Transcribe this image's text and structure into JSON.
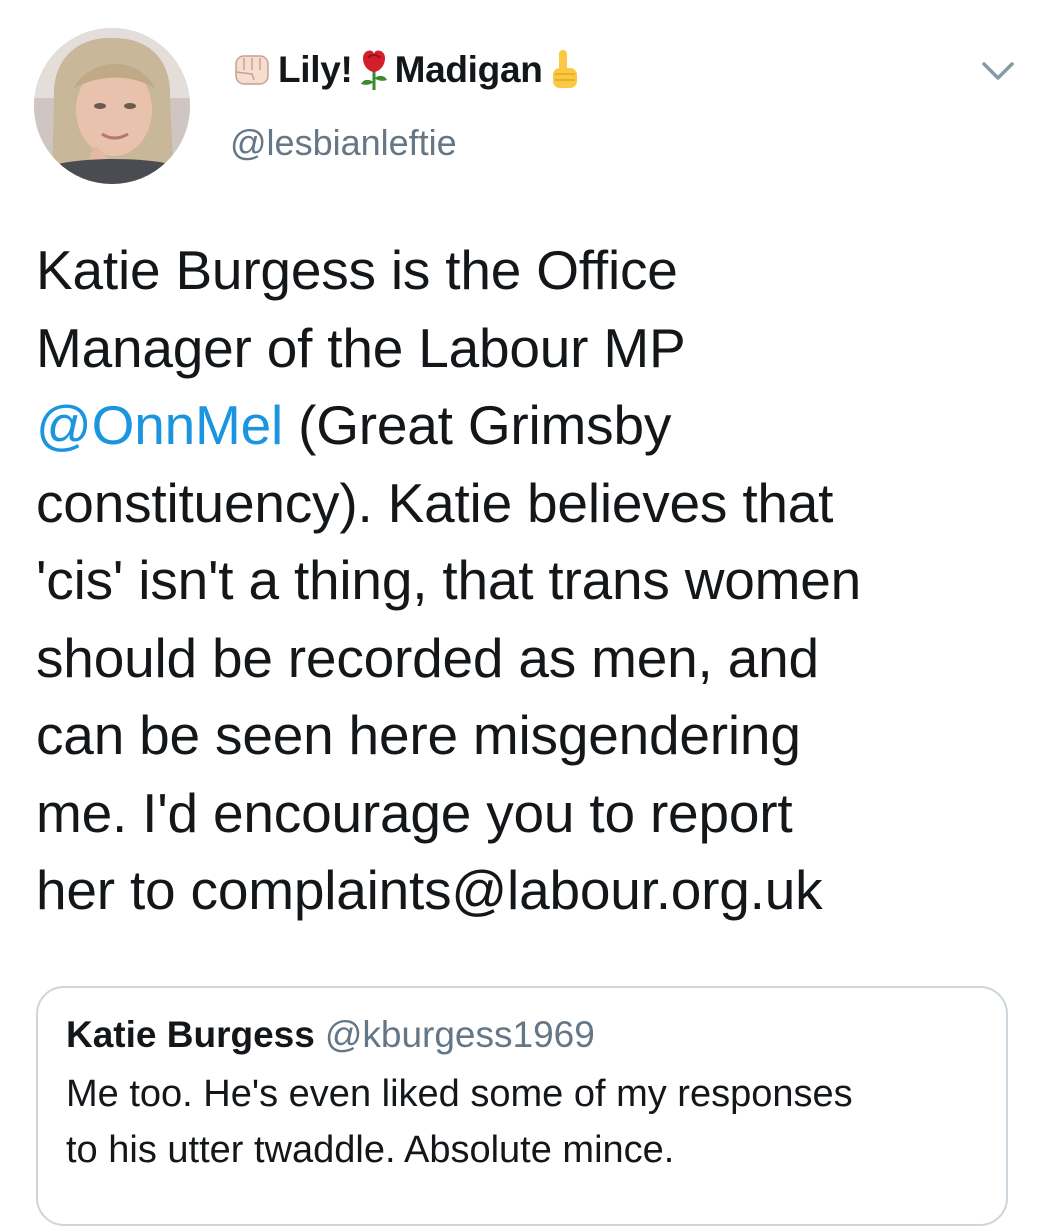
{
  "tweet": {
    "author": {
      "name_part_1": "Lily!",
      "name_part_2": "Madigan",
      "handle": "@lesbianleftie",
      "emoji_left": "raised-fist-icon",
      "emoji_middle": "rose-icon",
      "emoji_right": "pointing-up-icon"
    },
    "body": {
      "line1": "Katie Burgess is the Office",
      "line2": "Manager of the Labour MP",
      "mention": "@OnnMel",
      "line3_rest": " (Great Grimsby",
      "line4": "constituency). Katie believes that",
      "line5": "'cis' isn't a thing, that trans women",
      "line6": "should be recorded as men, and",
      "line7": "can be seen here misgendering",
      "line8": "me. I'd encourage you to report",
      "line9": "her to complaints@labour.org.uk"
    },
    "quoted": {
      "name": "Katie Burgess",
      "handle": "@kburgess1969",
      "line1": "Me too. He's even liked some of my responses",
      "line2": "to his utter twaddle. Absolute mince."
    }
  },
  "colors": {
    "link": "#1b95e0",
    "secondary_text": "#657786",
    "border": "#ccd6dd"
  }
}
